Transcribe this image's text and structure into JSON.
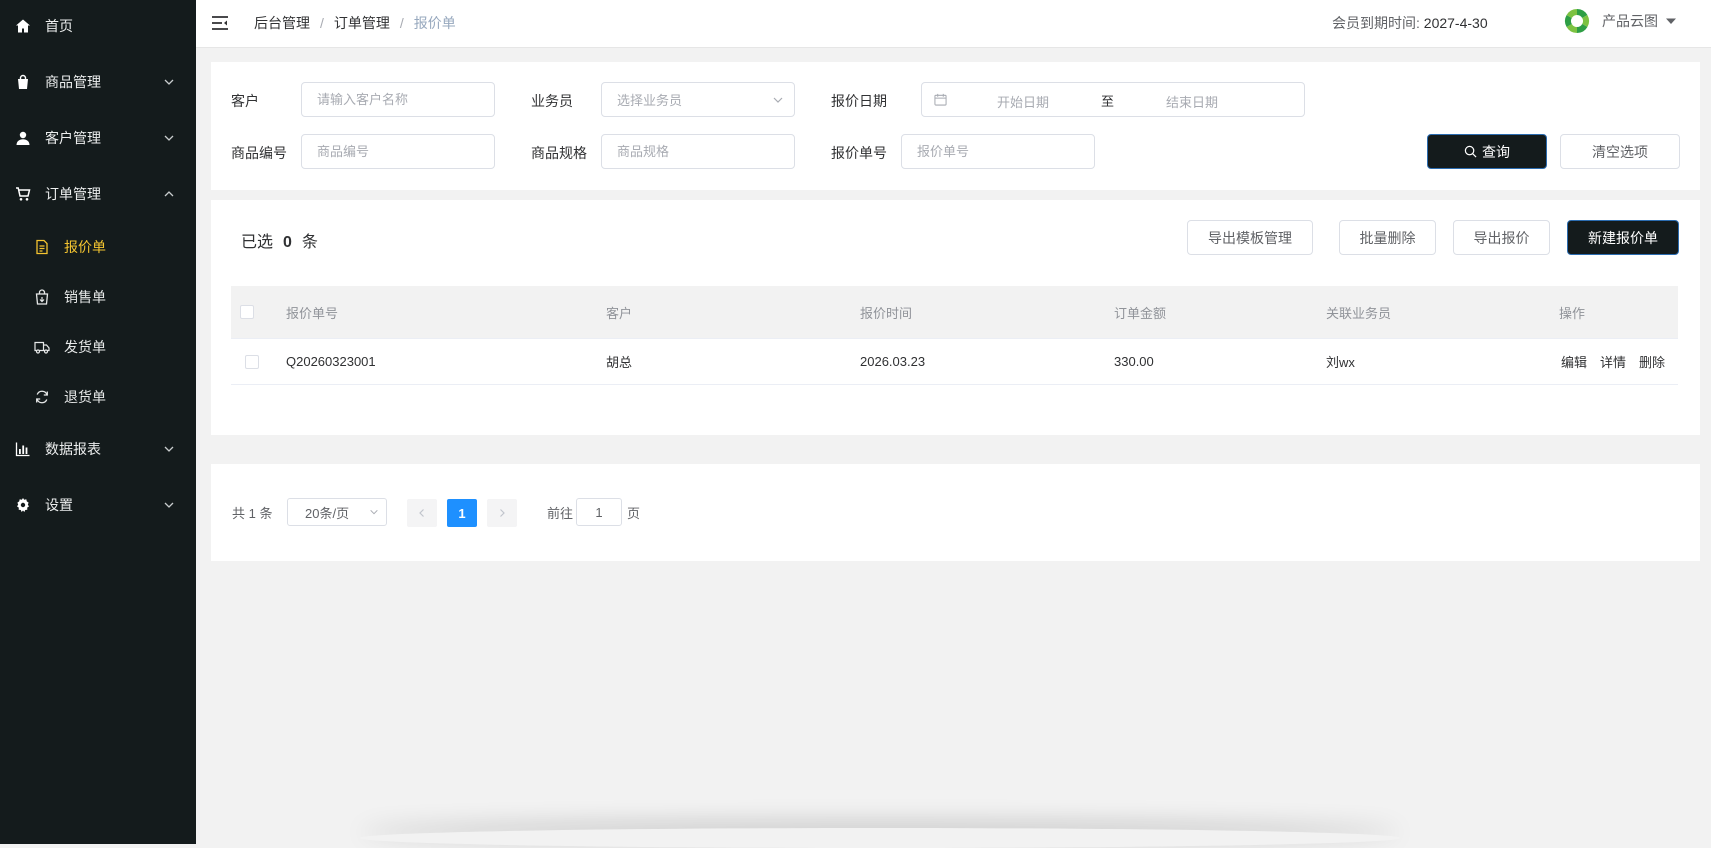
{
  "sidebar": {
    "items": [
      {
        "label": "首页"
      },
      {
        "label": "商品管理"
      },
      {
        "label": "客户管理"
      },
      {
        "label": "订单管理"
      },
      {
        "label": "数据报表"
      },
      {
        "label": "设置"
      }
    ],
    "order_sub": [
      {
        "label": "报价单"
      },
      {
        "label": "销售单"
      },
      {
        "label": "发货单"
      },
      {
        "label": "退货单"
      }
    ]
  },
  "header": {
    "breadcrumb": [
      "后台管理",
      "订单管理",
      "报价单"
    ],
    "separator": "/",
    "expire_label": "会员到期时间:",
    "expire_date": "2027-4-30",
    "brand_name": "产品云图"
  },
  "filters": {
    "customer_label": "客户",
    "customer_placeholder": "请输入客户名称",
    "sales_label": "业务员",
    "sales_placeholder": "选择业务员",
    "date_label": "报价日期",
    "date_start_placeholder": "开始日期",
    "date_to": "至",
    "date_end_placeholder": "结束日期",
    "code_label": "商品编号",
    "code_placeholder": "商品编号",
    "spec_label": "商品规格",
    "spec_placeholder": "商品规格",
    "quote_no_label": "报价单号",
    "quote_no_placeholder": "报价单号",
    "query_button": "查询",
    "clear_button": "清空选项"
  },
  "toolbar": {
    "selected_prefix": "已选",
    "selected_count": "0",
    "selected_suffix": "条",
    "export_template_button": "导出模板管理",
    "batch_delete_button": "批量删除",
    "export_quote_button": "导出报价",
    "new_quote_button": "新建报价单"
  },
  "table": {
    "headers": [
      "报价单号",
      "客户",
      "报价时间",
      "订单金额",
      "关联业务员",
      "操作"
    ],
    "rows": [
      {
        "quote_no": "Q20260323001",
        "customer": "胡总",
        "time": "2026.03.23",
        "amount": "330.00",
        "sales": "刘wx",
        "ops": [
          "编辑",
          "详情",
          "删除"
        ]
      }
    ]
  },
  "pagination": {
    "total": "共 1 条",
    "page_size": "20条/页",
    "current_page": "1",
    "goto_prefix": "前往",
    "goto_value": "1",
    "goto_suffix": "页"
  },
  "colors": {
    "sidebar_bg": "#141b1c",
    "active_menu": "#f4c430",
    "primary_dark_button": "#141b1c",
    "pager_active": "#1e90ff"
  }
}
